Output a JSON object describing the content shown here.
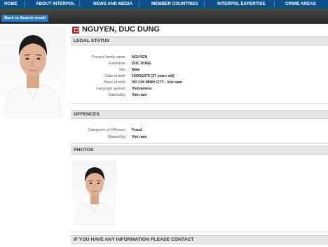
{
  "nav": {
    "items": [
      "HOME",
      "ABOUT INTERPOL",
      "NEWS AND MEDIA",
      "MEMBER COUNTRIES",
      "INTERPOL EXPERTISE",
      "CRIME AREAS"
    ]
  },
  "toolbar": {
    "back_label": "Back to Search result"
  },
  "notice": {
    "name": "NGUYEN, DUC DUNG",
    "legal_status": {
      "title": "LEGAL STATUS",
      "fields": [
        {
          "label": "Present family name:",
          "value": "NGUYEN"
        },
        {
          "label": "Forename:",
          "value": "DUC DUNG"
        },
        {
          "label": "Sex:",
          "value": "Male"
        },
        {
          "label": "Date of birth:",
          "value": "15/03/1975 (37 years old)"
        },
        {
          "label": "Place of birth:",
          "value": "HO CHI MINH CITY , Viet nam"
        },
        {
          "label": "Language spoken:",
          "value": "Vietnamese"
        },
        {
          "label": "Nationality:",
          "value": "Viet nam"
        }
      ]
    },
    "offences": {
      "title": "OFFENCES",
      "fields": [
        {
          "label": "Categories of Offences:",
          "value": "Fraud"
        },
        {
          "label": "Wanted by:",
          "value": "Viet nam"
        }
      ]
    },
    "photos_title": "PHOTOS",
    "contact_title": "IF YOU HAVE ANY INFORMATION PLEASE CONTACT"
  },
  "colors": {
    "nav_bg": "#0d4f88",
    "back_button": "#2b7ac0",
    "notice_icon": "#c8221d",
    "section_bg": "#e6e6e6"
  },
  "icons": [
    "red-notice-icon"
  ]
}
